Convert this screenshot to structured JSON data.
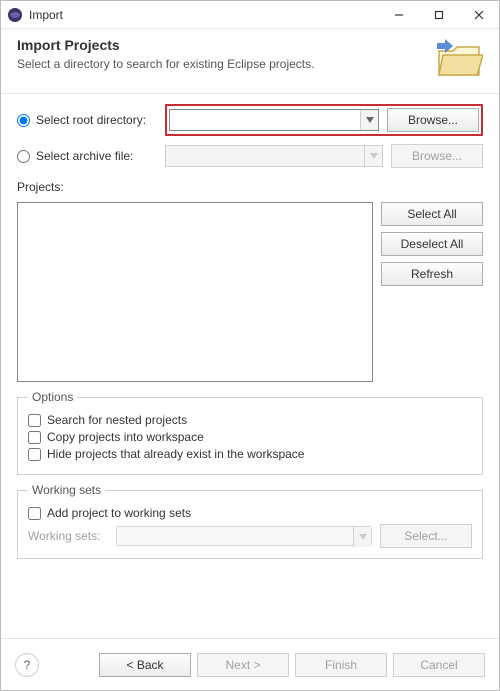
{
  "titlebar": {
    "title": "Import"
  },
  "banner": {
    "heading": "Import Projects",
    "sub": "Select a directory to search for existing Eclipse projects."
  },
  "source": {
    "root_label": "Select root directory:",
    "archive_label": "Select archive file:",
    "root_value": "",
    "archive_value": "",
    "browse": "Browse..."
  },
  "projects": {
    "label": "Projects:",
    "select_all": "Select All",
    "deselect_all": "Deselect All",
    "refresh": "Refresh"
  },
  "options": {
    "legend": "Options",
    "nested": "Search for nested projects",
    "copy": "Copy projects into workspace",
    "hide": "Hide projects that already exist in the workspace"
  },
  "working_sets": {
    "legend": "Working sets",
    "add": "Add project to working sets",
    "label": "Working sets:",
    "select": "Select..."
  },
  "buttons": {
    "back": "< Back",
    "next": "Next >",
    "finish": "Finish",
    "cancel": "Cancel"
  }
}
